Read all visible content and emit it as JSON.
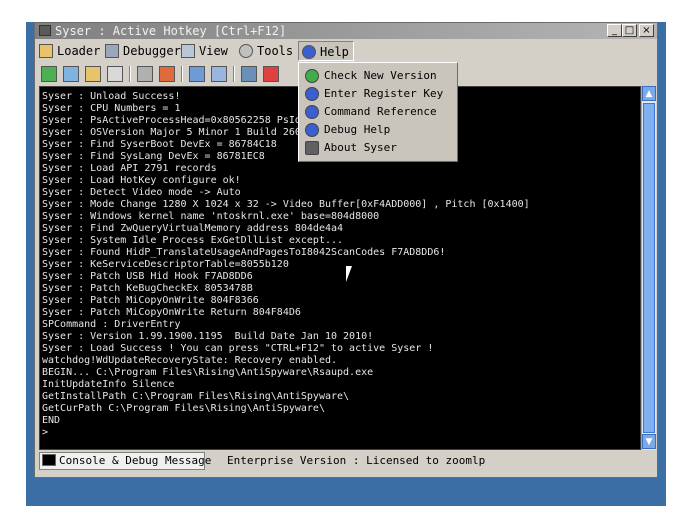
{
  "window": {
    "title": "Syser : Active Hotkey [Ctrl+F12]",
    "controls": [
      "_",
      "□",
      "×"
    ]
  },
  "menubar": {
    "items": [
      {
        "label": "Loader",
        "icon": "loader-icon"
      },
      {
        "label": "Debugger",
        "icon": "debugger-icon"
      },
      {
        "label": "View",
        "icon": "view-icon"
      },
      {
        "label": "Tools",
        "icon": "tools-icon"
      },
      {
        "label": "Help",
        "icon": "help-icon"
      }
    ]
  },
  "help_menu": {
    "items": [
      {
        "label": "Check New Version",
        "icon": "globe-icon"
      },
      {
        "label": "Enter Register Key",
        "icon": "help-circle-icon"
      },
      {
        "label": "Command Reference",
        "icon": "help-circle-icon"
      },
      {
        "label": "Debug Help",
        "icon": "help-circle-icon"
      },
      {
        "label": "About Syser",
        "icon": "syser-logo-icon"
      }
    ]
  },
  "console": {
    "lines": [
      "Syser : Unload Success!",
      "Syser : CPU Numbers = 1",
      "Syser : PsActiveProcessHead=0x80562258 PsId",
      "Syser : OSVersion Major 5 Minor 1 Build 260",
      "Syser : Find SyserBoot DevEx = 86784C18",
      "Syser : Find SysLang DevEx = 86781EC8",
      "Syser : Load API 2791 records",
      "Syser : Load HotKey configure ok!",
      "Syser : Detect Video mode -> Auto",
      "Syser : Mode Change 1280 X 1024 x 32 -> Video Buffer[0xF4ADD000] , Pitch [0x1400]",
      "Syser : Windows kernel name 'ntoskrnl.exe' base=804d8000",
      "Syser : Find ZwQueryVirtualMemory address 804de4a4",
      "Syser : System Idle Process ExGetDllList except...",
      "Syser : Found HidP_TranslateUsageAndPagesToI8042ScanCodes F7AD8DD6!",
      "Syser : KeServiceDescriptorTable=8055b120",
      "Syser : Patch USB Hid Hook F7AD8DD6",
      "Syser : Patch KeBugCheckEx 8053478B",
      "Syser : Patch MiCopyOnWrite 804F8366",
      "Syser : Patch MiCopyOnWrite Return 804F84D6",
      "SPCommand : DriverEntry",
      "Syser : Version 1.99.1900.1195  Build Date Jan 10 2010!",
      "Syser : Load Success ! You can press \"CTRL+F12\" to active Syser !",
      "watchdog!WdUpdateRecoveryState: Recovery enabled.",
      "BEGIN... C:\\Program Files\\Rising\\AntiSpyware\\Rsaupd.exe",
      "InitUpdateInfo Silence",
      "GetInstallPath C:\\Program Files\\Rising\\AntiSpyware\\",
      "GetCurPath C:\\Program Files\\Rising\\AntiSpyware\\",
      "END",
      ">"
    ]
  },
  "statusbar": {
    "tab_label": "Console & Debug Message",
    "status_text": "Enterprise Version : Licensed to zoomlp"
  },
  "colors": {
    "desktop": "#3a6ea5",
    "console_bg": "#000000",
    "console_text": "#e6e6e6"
  }
}
